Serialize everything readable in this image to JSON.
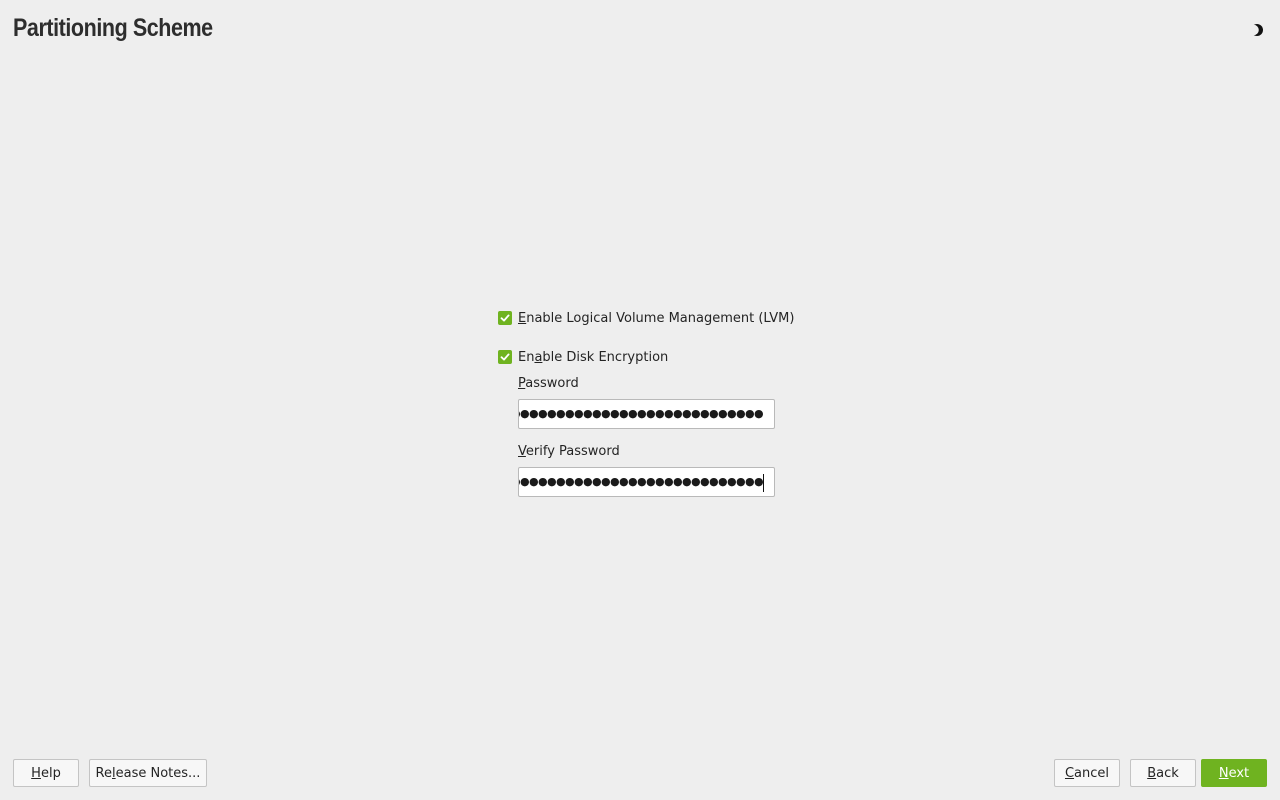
{
  "header": {
    "title": "Partitioning Scheme",
    "theme_toggle_icon": "half-moon-icon"
  },
  "options": {
    "lvm": {
      "checked": true,
      "label_accel": "E",
      "label_rest": "nable Logical Volume Management (LVM)"
    },
    "encryption": {
      "checked": true,
      "label_pre": "En",
      "label_accel": "a",
      "label_rest": "ble Disk Encryption"
    }
  },
  "password": {
    "label_accel": "P",
    "label_rest": "assword",
    "masked_value": "●●●●●●●●●●●●●●●●●●●●●●●●●●●●●●●●●"
  },
  "verify_password": {
    "label_accel": "V",
    "label_rest": "erify Password",
    "masked_value": "●●●●●●●●●●●●●●●●●●●●●●●●●●●●●●●●●"
  },
  "footer": {
    "help": {
      "accel": "H",
      "rest": "elp"
    },
    "release_notes": {
      "pre": "Re",
      "accel": "l",
      "rest": "ease Notes..."
    },
    "cancel": {
      "accel": "C",
      "rest": "ancel"
    },
    "back": {
      "accel": "B",
      "rest": "ack"
    },
    "next": {
      "accel": "N",
      "rest": "ext"
    }
  },
  "colors": {
    "accent": "#6fb320",
    "background": "#eeeeee"
  }
}
